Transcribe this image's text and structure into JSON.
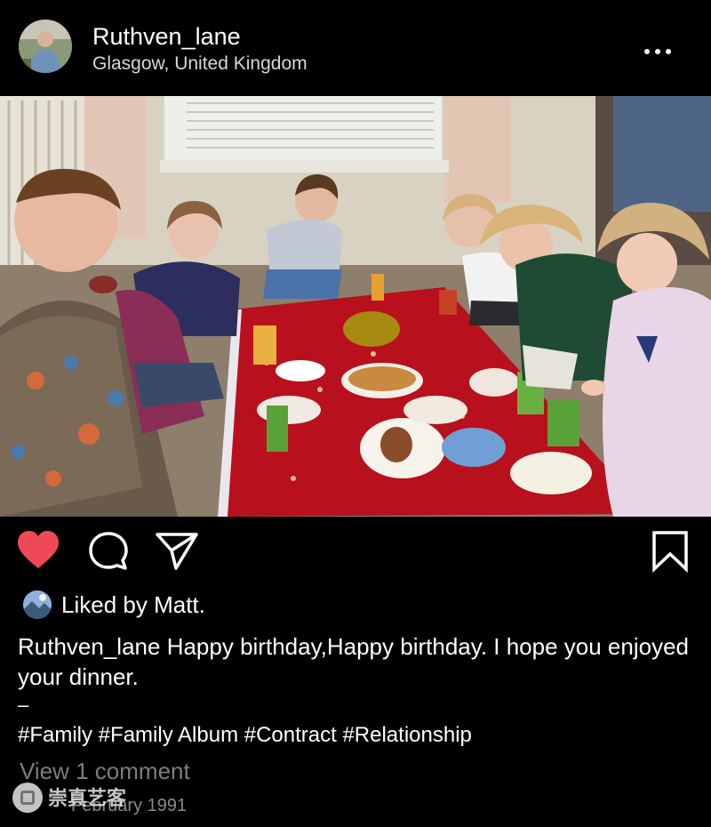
{
  "post": {
    "username": "Ruthven_lane",
    "location": "Glasgow, United Kingdom",
    "liked_by_prefix": "Liked by ",
    "liked_by_user": "Matt.",
    "caption_user": "Ruthven_lane",
    "caption_text": " Happy birthday,Happy birthday. I hope you enjoyed your dinner.",
    "separator": "–",
    "hashtags": "#Family #Family Album #Contract #Relationship",
    "view_comments": "View 1 comment",
    "date": "February 1991",
    "liked": true
  },
  "icons": {
    "like": "heart-icon",
    "comment": "comment-bubble-icon",
    "share": "paper-plane-icon",
    "save": "bookmark-icon",
    "more": "more-dots-icon"
  },
  "colors": {
    "background": "#000000",
    "like_red": "#ed4956",
    "secondary_text": "#7d7d7d"
  },
  "watermark": {
    "text": "崇真艺客"
  }
}
